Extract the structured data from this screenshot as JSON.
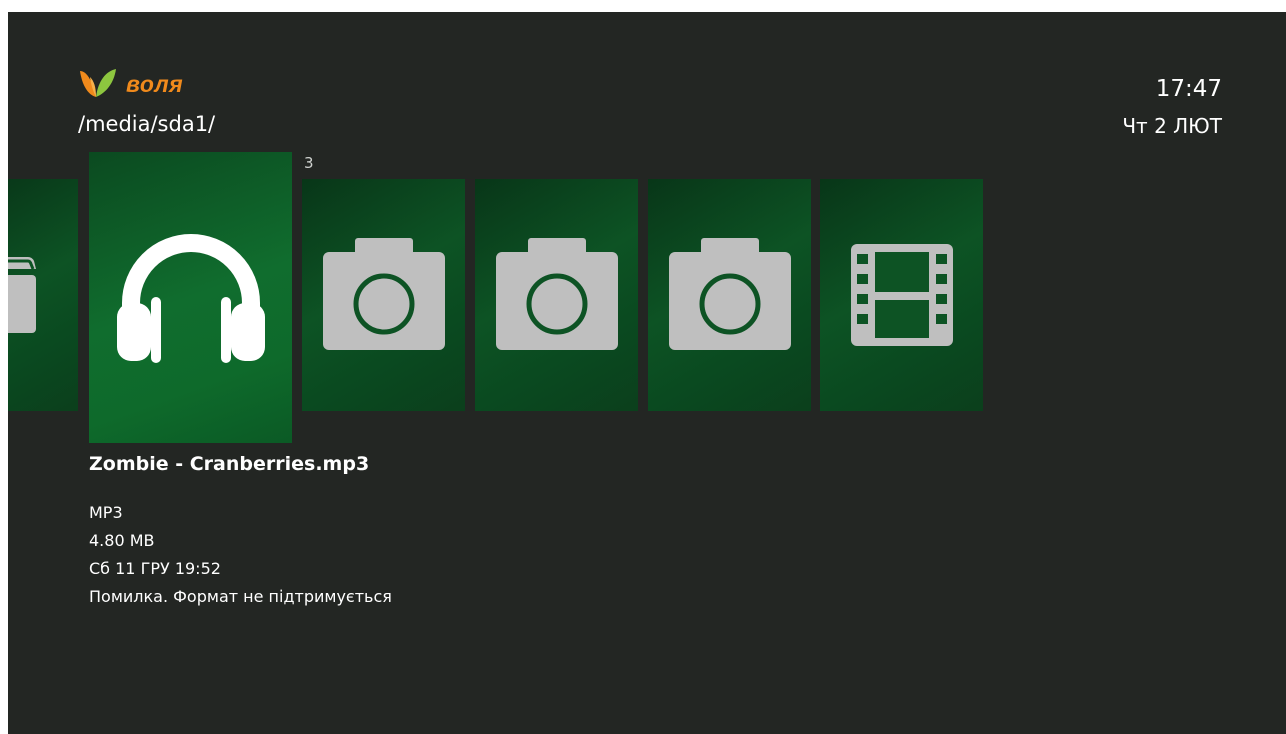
{
  "header": {
    "logo_text": "воля",
    "path": "/media/sda1/",
    "time": "17:47",
    "date": "Чт 2 ЛЮТ"
  },
  "carousel": {
    "position_counter": "3",
    "items": [
      {
        "type": "folder",
        "icon": "folder-icon"
      },
      {
        "type": "audio",
        "icon": "headphones-icon",
        "selected": true
      },
      {
        "type": "photo",
        "icon": "camera-icon"
      },
      {
        "type": "photo",
        "icon": "camera-icon"
      },
      {
        "type": "photo",
        "icon": "camera-icon"
      },
      {
        "type": "video",
        "icon": "film-icon"
      }
    ]
  },
  "details": {
    "filename": "Zombie - Cranberries.mp3",
    "format": "MP3",
    "size": "4.80 MB",
    "modified": "Сб 11 ГРУ 19:52",
    "status": "Помилка. Формат не підтримується"
  },
  "colors": {
    "background": "#232623",
    "tile": "#0d5324",
    "tile_selected": "#106d2e",
    "logo_orange": "#f08a1c",
    "logo_green": "#8dc63f",
    "icon_gray": "#bfbfbf"
  }
}
